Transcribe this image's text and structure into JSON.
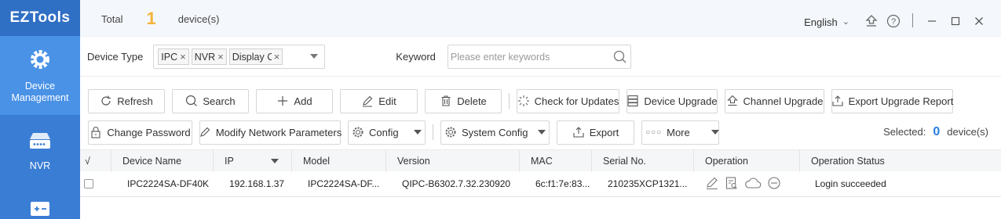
{
  "app": {
    "name": "EZTools"
  },
  "sidebar": {
    "items": [
      {
        "label": "Device\nManagement",
        "icon": "gear-icon",
        "active": true
      },
      {
        "label": "NVR",
        "icon": "nvr-icon",
        "active": false
      },
      {
        "label": "",
        "icon": "config-icon",
        "active": false
      }
    ]
  },
  "header": {
    "total_label": "Total",
    "total_count": "1",
    "total_unit": "device(s)",
    "language": "English"
  },
  "filters": {
    "device_type_label": "Device Type",
    "device_type_tags": [
      "IPC",
      "NVR",
      "Display C"
    ],
    "keyword_label": "Keyword",
    "keyword_placeholder": "Please enter keywords"
  },
  "toolbar1": {
    "refresh": "Refresh",
    "search": "Search",
    "add": "Add",
    "edit": "Edit",
    "delete": "Delete",
    "check_updates": "Check for Updates",
    "device_upgrade": "Device Upgrade",
    "channel_upgrade": "Channel Upgrade",
    "export_upgrade_report": "Export Upgrade Report"
  },
  "toolbar2": {
    "change_password": "Change Password",
    "modify_network": "Modify Network Parameters",
    "config": "Config",
    "system_config": "System Config",
    "export": "Export",
    "more": "More",
    "selected_label": "Selected:",
    "selected_count": "0",
    "selected_unit": "device(s)"
  },
  "table": {
    "check_header": "√",
    "columns": [
      "Device Name",
      "IP",
      "Model",
      "Version",
      "MAC",
      "Serial No.",
      "Operation",
      "Operation Status"
    ],
    "rows": [
      {
        "device_name": "IPC2224SA-DF40K",
        "ip": "192.168.1.37",
        "model": "IPC2224SA-DF...",
        "version": "QIPC-B6302.7.32.230920",
        "mac": "6c:f1:7e:83...",
        "serial": "210235XCP1321...",
        "status": "Login succeeded"
      }
    ]
  },
  "colors": {
    "sidebar": "#3a7dd4",
    "sidebar_active": "#4a92e6",
    "accent_count": "#f4b43a",
    "selected_count": "#2a7de1"
  }
}
